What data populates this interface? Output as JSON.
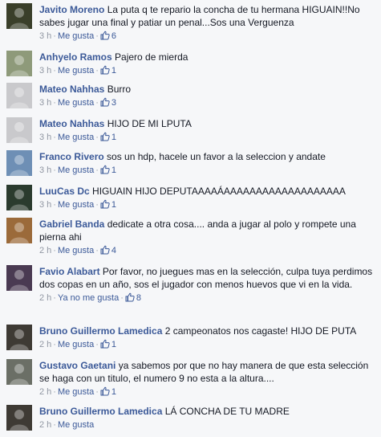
{
  "comments": [
    {
      "author": "Javito Moreno",
      "text": "La puta q te repario la concha de tu hermana HIGUAIN!!No sabes jugar una final y patiar un penal...Sos una Verguenza",
      "time": "3 h",
      "action": "Me gusta",
      "likes": "6",
      "avatar_color": "#3a3f2a"
    },
    {
      "author": "Anhyelo Ramos",
      "text": "Pajero de mierda",
      "time": "3 h",
      "action": "Me gusta",
      "likes": "1",
      "avatar_color": "#8e9a7a"
    },
    {
      "author": "Mateo Nahhas",
      "text": "Burro",
      "time": "3 h",
      "action": "Me gusta",
      "likes": "3",
      "avatar_color": "#c9c9cc"
    },
    {
      "author": "Mateo Nahhas",
      "text": "HIJO DE MI LPUTA",
      "time": "3 h",
      "action": "Me gusta",
      "likes": "1",
      "avatar_color": "#c9c9cc"
    },
    {
      "author": "Franco Rivero",
      "text": "sos un hdp, hacele un favor a la seleccion y andate",
      "time": "3 h",
      "action": "Me gusta",
      "likes": "1",
      "avatar_color": "#6e8fb5"
    },
    {
      "author": "LuuCas Dc",
      "text": "HIGUAIN HIJO DEPUTAAAAÁAAAAAAAAAAAAAAAAAAA",
      "time": "3 h",
      "action": "Me gusta",
      "likes": "1",
      "avatar_color": "#2b3b2e"
    },
    {
      "author": "Gabriel Banda",
      "text": "dedicate a otra cosa.... anda a jugar al polo y rompete una pierna ahi",
      "time": "2 h",
      "action": "Me gusta",
      "likes": "4",
      "avatar_color": "#9b6a3a"
    },
    {
      "author": "Favio Alabart",
      "text": "Por favor, no juegues mas en la selección, culpa tuya perdimos dos copas en un año, sos el jugador con menos huevos que vi en la vida.",
      "time": "2 h",
      "action": "Ya no me gusta",
      "likes": "8",
      "avatar_color": "#4a3a52"
    },
    {
      "author": "Bruno Guillermo Lamedica",
      "text": "2 campeonatos nos cagaste! HIJO DE PUTA",
      "time": "2 h",
      "action": "Me gusta",
      "likes": "1",
      "avatar_color": "#3e3a34"
    },
    {
      "author": "Gustavo Gaetani",
      "text": "ya sabemos por que no hay manera de que esta selección se haga con un titulo, el numero 9 no esta a la altura....",
      "time": "2 h",
      "action": "Me gusta",
      "likes": "1",
      "avatar_color": "#6b6f66"
    },
    {
      "author": "Bruno Guillermo Lamedica",
      "text": "LÁ CONCHA DE TU MADRE",
      "time": "2 h",
      "action": "Me gusta",
      "likes": "",
      "avatar_color": "#3e3a34"
    }
  ]
}
